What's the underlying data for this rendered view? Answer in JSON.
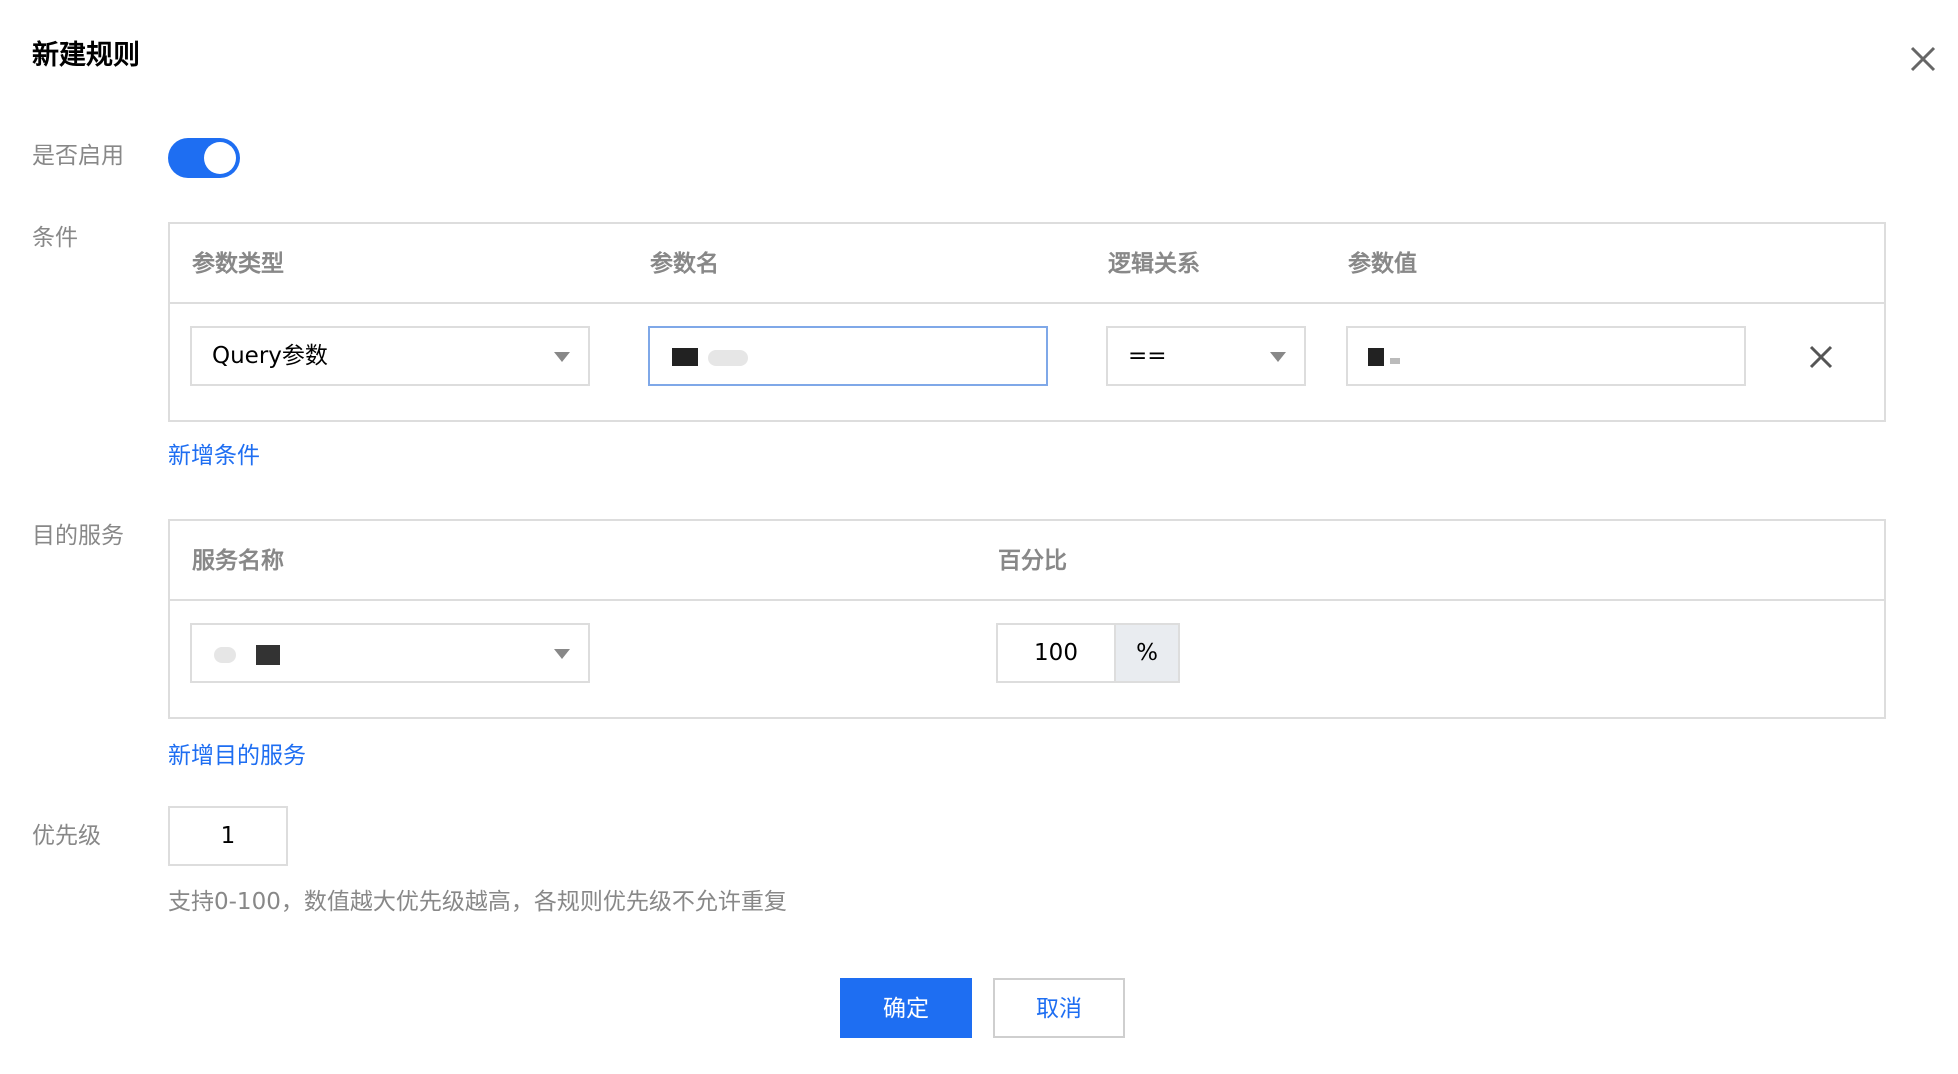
{
  "dialog": {
    "title": "新建规则",
    "enable_label": "是否启用",
    "enabled": true
  },
  "conditions": {
    "label": "条件",
    "columns": [
      "参数类型",
      "参数名",
      "逻辑关系",
      "参数值"
    ],
    "rows": [
      {
        "param_type": "Query参数",
        "param_name": "",
        "operator": "==",
        "param_value": ""
      }
    ],
    "add_label": "新增条件"
  },
  "destinations": {
    "label": "目的服务",
    "columns": [
      "服务名称",
      "百分比"
    ],
    "rows": [
      {
        "service_name": "",
        "percent": "100",
        "unit": "%"
      }
    ],
    "add_label": "新增目的服务"
  },
  "priority": {
    "label": "优先级",
    "value": "1",
    "hint": "支持0-100，数值越大优先级越高，各规则优先级不允许重复"
  },
  "actions": {
    "confirm_label": "确定",
    "cancel_label": "取消"
  },
  "colors": {
    "accent": "#1e6ef2",
    "border": "#dddddd",
    "muted_text": "#888888"
  },
  "icons": {
    "close": "close-icon",
    "remove_row": "close-icon",
    "dropdown": "chevron-down-icon"
  }
}
